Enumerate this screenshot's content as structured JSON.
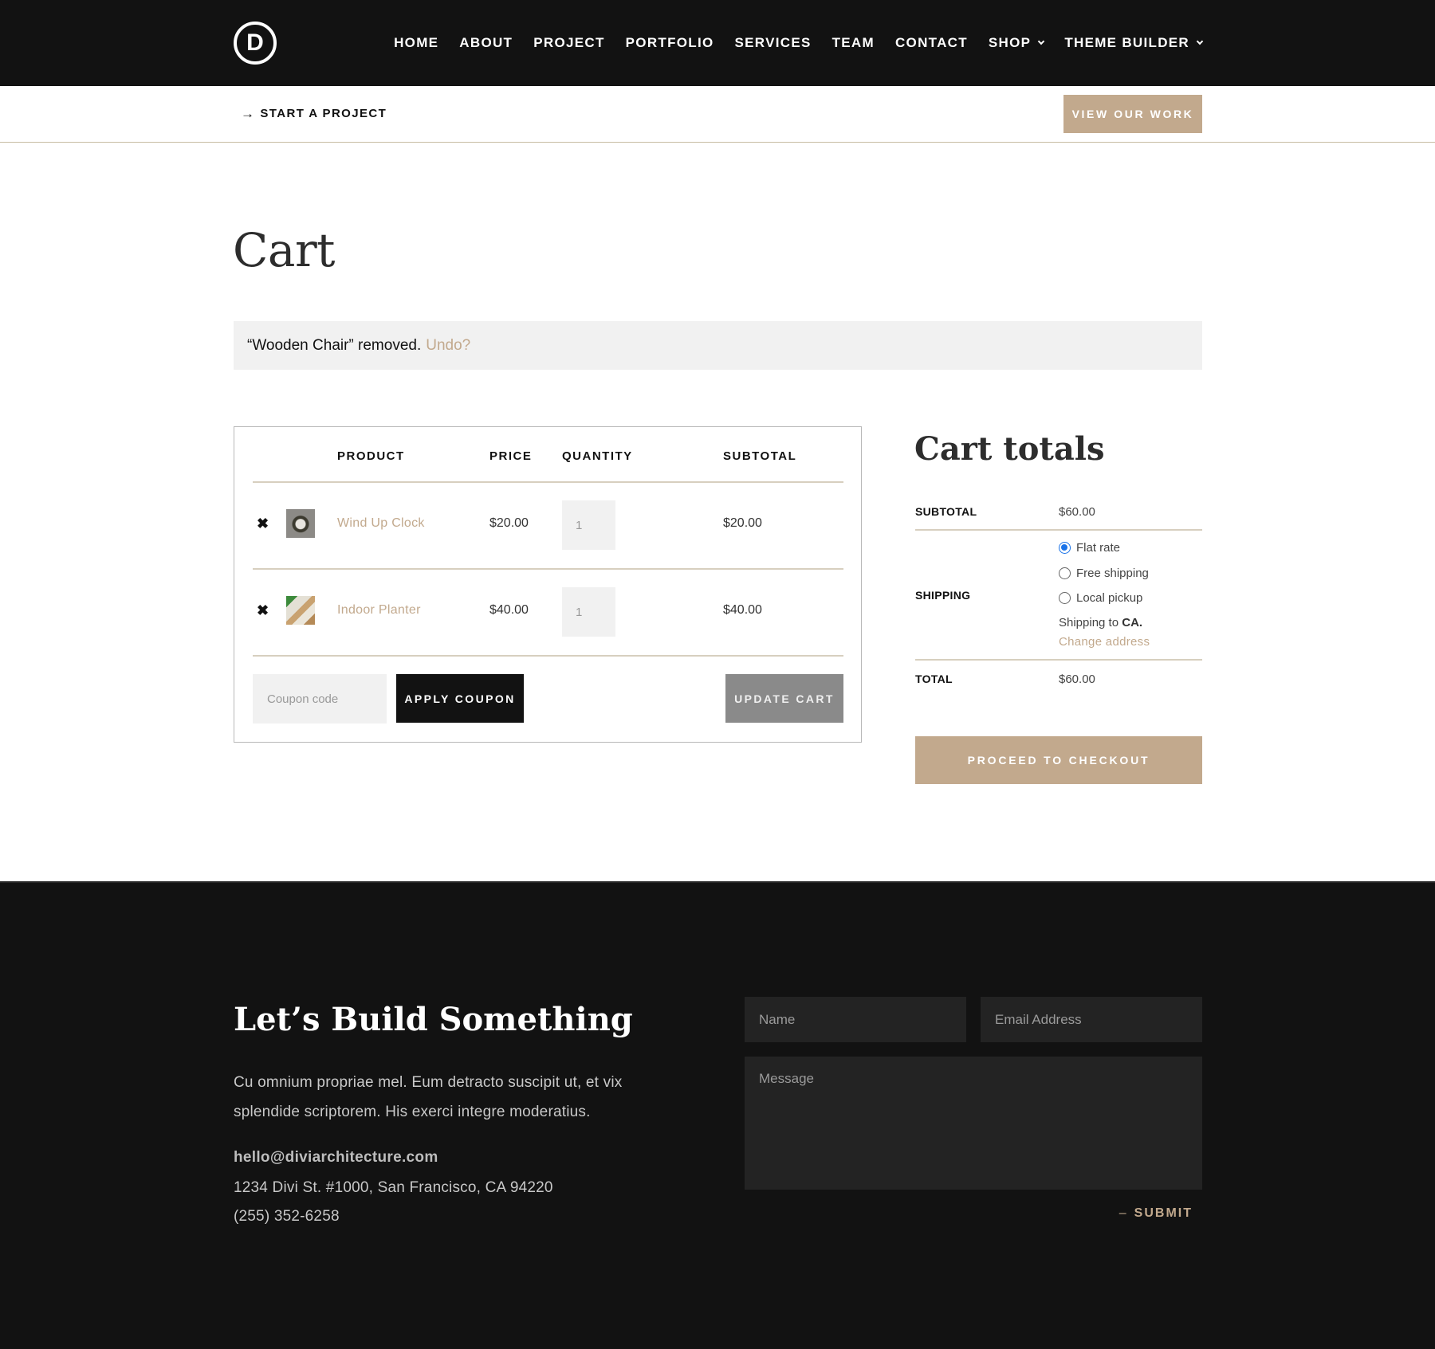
{
  "header": {
    "logo_letter": "D",
    "nav": [
      {
        "label": "HOME",
        "has_dropdown": false
      },
      {
        "label": "ABOUT",
        "has_dropdown": false
      },
      {
        "label": "PROJECT",
        "has_dropdown": false
      },
      {
        "label": "PORTFOLIO",
        "has_dropdown": false
      },
      {
        "label": "SERVICES",
        "has_dropdown": false
      },
      {
        "label": "TEAM",
        "has_dropdown": false
      },
      {
        "label": "CONTACT",
        "has_dropdown": false
      },
      {
        "label": "SHOP",
        "has_dropdown": true
      },
      {
        "label": "THEME BUILDER",
        "has_dropdown": true
      }
    ]
  },
  "subbar": {
    "start_project_icon": "arrow-right-icon",
    "start_project_glyph": "→",
    "start_project_label": "START A PROJECT",
    "view_work_label": "VIEW OUR WORK"
  },
  "page": {
    "title": "Cart"
  },
  "notice": {
    "message": "“Wooden Chair” removed.",
    "undo_label": "Undo?"
  },
  "cart": {
    "columns": [
      "PRODUCT",
      "PRICE",
      "QUANTITY",
      "SUBTOTAL"
    ],
    "remove_glyph": "✖",
    "items": [
      {
        "name": "Wind Up Clock",
        "thumb": "clock-thumbnail",
        "price": "$20.00",
        "quantity": "1",
        "subtotal": "$20.00"
      },
      {
        "name": "Indoor Planter",
        "thumb": "planter-thumbnail",
        "price": "$40.00",
        "quantity": "1",
        "subtotal": "$40.00"
      }
    ],
    "coupon_placeholder": "Coupon code",
    "apply_coupon_label": "APPLY COUPON",
    "update_cart_label": "UPDATE CART"
  },
  "totals": {
    "title": "Cart totals",
    "subtotal_label": "SUBTOTAL",
    "subtotal_value": "$60.00",
    "shipping_label": "SHIPPING",
    "shipping_options": [
      {
        "label": "Flat rate",
        "selected": true
      },
      {
        "label": "Free shipping",
        "selected": false
      },
      {
        "label": "Local pickup",
        "selected": false
      }
    ],
    "shipping_to_prefix": "Shipping to",
    "shipping_to_region": "CA.",
    "change_address_label": "Change address",
    "total_label": "TOTAL",
    "total_value": "$60.00",
    "checkout_label": "PROCEED TO CHECKOUT"
  },
  "footer": {
    "title": "Let’s Build Something",
    "text": "Cu omnium propriae mel. Eum detracto suscipit ut, et vix splendide scriptorem. His exerci integre moderatius.",
    "email": "hello@diviarchitecture.com",
    "address": "1234 Divi St. #1000, San Francisco, CA 94220",
    "phone": "(255) 352-6258",
    "form": {
      "name_placeholder": "Name",
      "email_placeholder": "Email Address",
      "message_placeholder": "Message",
      "submit_dash": "–",
      "submit_label": "SUBMIT"
    }
  },
  "colors": {
    "accent": "#c2a98d",
    "dark": "#121212",
    "radio_selected": "#1a73e8",
    "update_button": "#8a8a8a"
  }
}
